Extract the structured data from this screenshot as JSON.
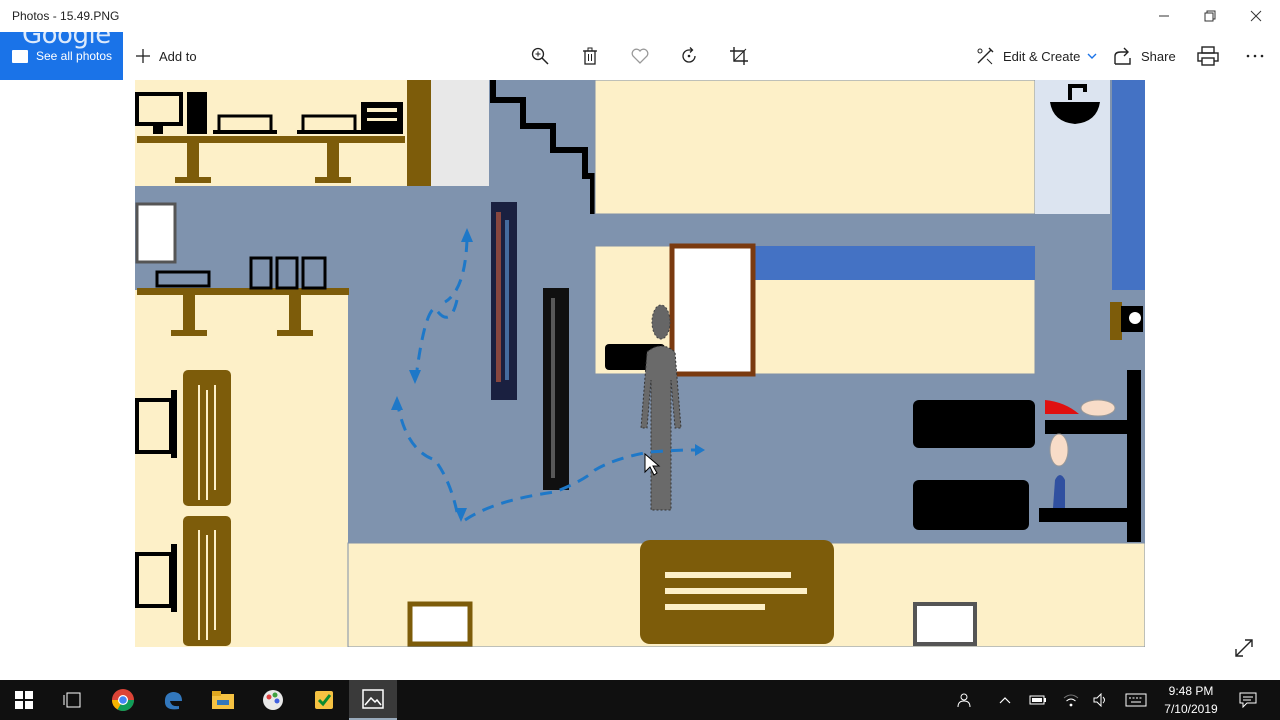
{
  "window": {
    "title": "Photos - 15.49.PNG",
    "minimize_icon": "minimize-icon",
    "restore_icon": "restore-icon",
    "close_icon": "close-icon"
  },
  "google_photos": {
    "logo_text": "Google",
    "see_all": "See all photos",
    "brand_color": "#1a73e8"
  },
  "toolbar": {
    "add_to": "Add to",
    "edit_create": "Edit & Create",
    "share": "Share",
    "icons": [
      "zoom-in-icon",
      "delete-icon",
      "favorite-icon",
      "rotate-icon",
      "crop-icon",
      "print-icon",
      "more-icon"
    ]
  },
  "image": {
    "description_colors": {
      "floor": "#7f93ae",
      "room": "#fdf0c8",
      "furniture": "#7d5c0a",
      "path_arrow": "#1e78c8",
      "blue_counter": "#4472c4"
    }
  },
  "taskbar": {
    "apps": [
      "windows-start",
      "task-view",
      "chrome",
      "edge",
      "file-explorer",
      "paint",
      "snipping-tool",
      "photos"
    ],
    "time": "9:48 PM",
    "date": "7/10/2019"
  }
}
